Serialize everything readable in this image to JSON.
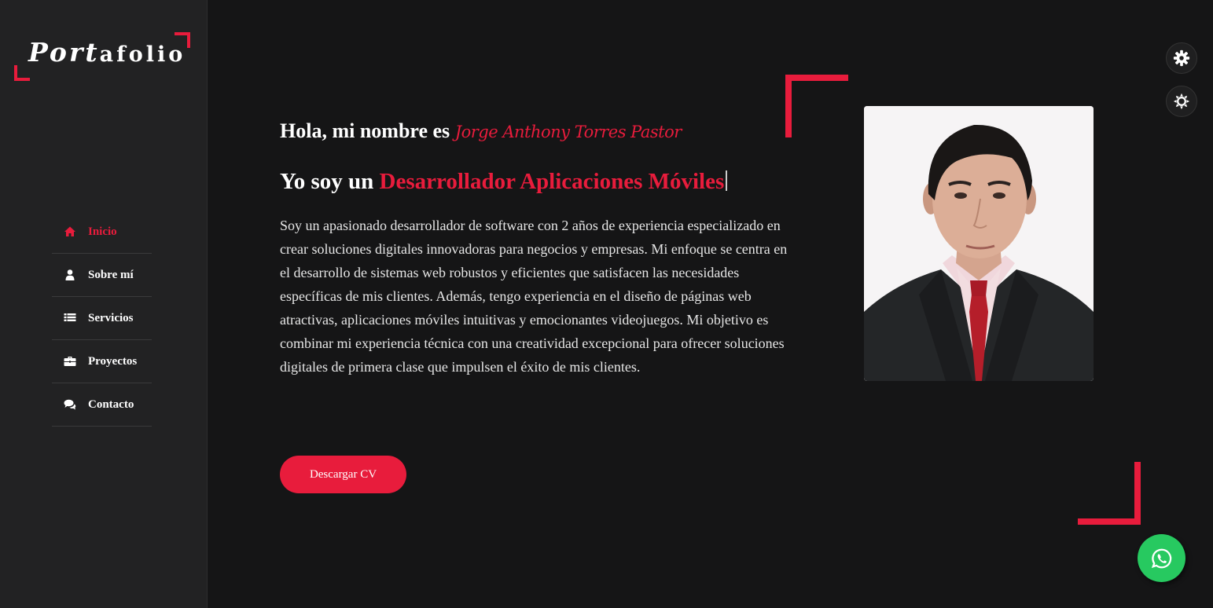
{
  "brand": {
    "logo_script": "Port",
    "logo_rest": "afolio"
  },
  "colors": {
    "accent": "#e81c3c",
    "background": "#151516",
    "sidebar": "#222223",
    "whatsapp": "#27c960"
  },
  "nav": {
    "items": [
      {
        "label": "Inicio",
        "icon": "home-icon",
        "active": true
      },
      {
        "label": "Sobre mí",
        "icon": "user-icon",
        "active": false
      },
      {
        "label": "Servicios",
        "icon": "list-icon",
        "active": false
      },
      {
        "label": "Proyectos",
        "icon": "briefcase-icon",
        "active": false
      },
      {
        "label": "Contacto",
        "icon": "chat-icon",
        "active": false
      }
    ]
  },
  "hero": {
    "greeting_prefix": "Hola, mi nombre es",
    "name": "Jorge Anthony Torres Pastor",
    "role_prefix": "Yo soy un",
    "role": "Desarrollador Aplicaciones Móviles",
    "bio": "Soy un apasionado desarrollador de software con 2 años de experiencia especializado en crear soluciones digitales innovadoras para negocios y empresas. Mi enfoque se centra en el desarrollo de sistemas web robustos y eficientes que satisfacen las necesidades específicas de mis clientes. Además, tengo experiencia en el diseño de páginas web atractivas, aplicaciones móviles intuitivas y emocionantes videojuegos. Mi objetivo es combinar mi experiencia técnica con una creatividad excepcional para ofrecer soluciones digitales de primera clase que impulsen el éxito de mis clientes.",
    "cv_button": "Descargar CV"
  },
  "controls": {
    "settings_icon": "gear-icon",
    "theme_icon": "sun-icon",
    "whatsapp_icon": "whatsapp-icon"
  }
}
